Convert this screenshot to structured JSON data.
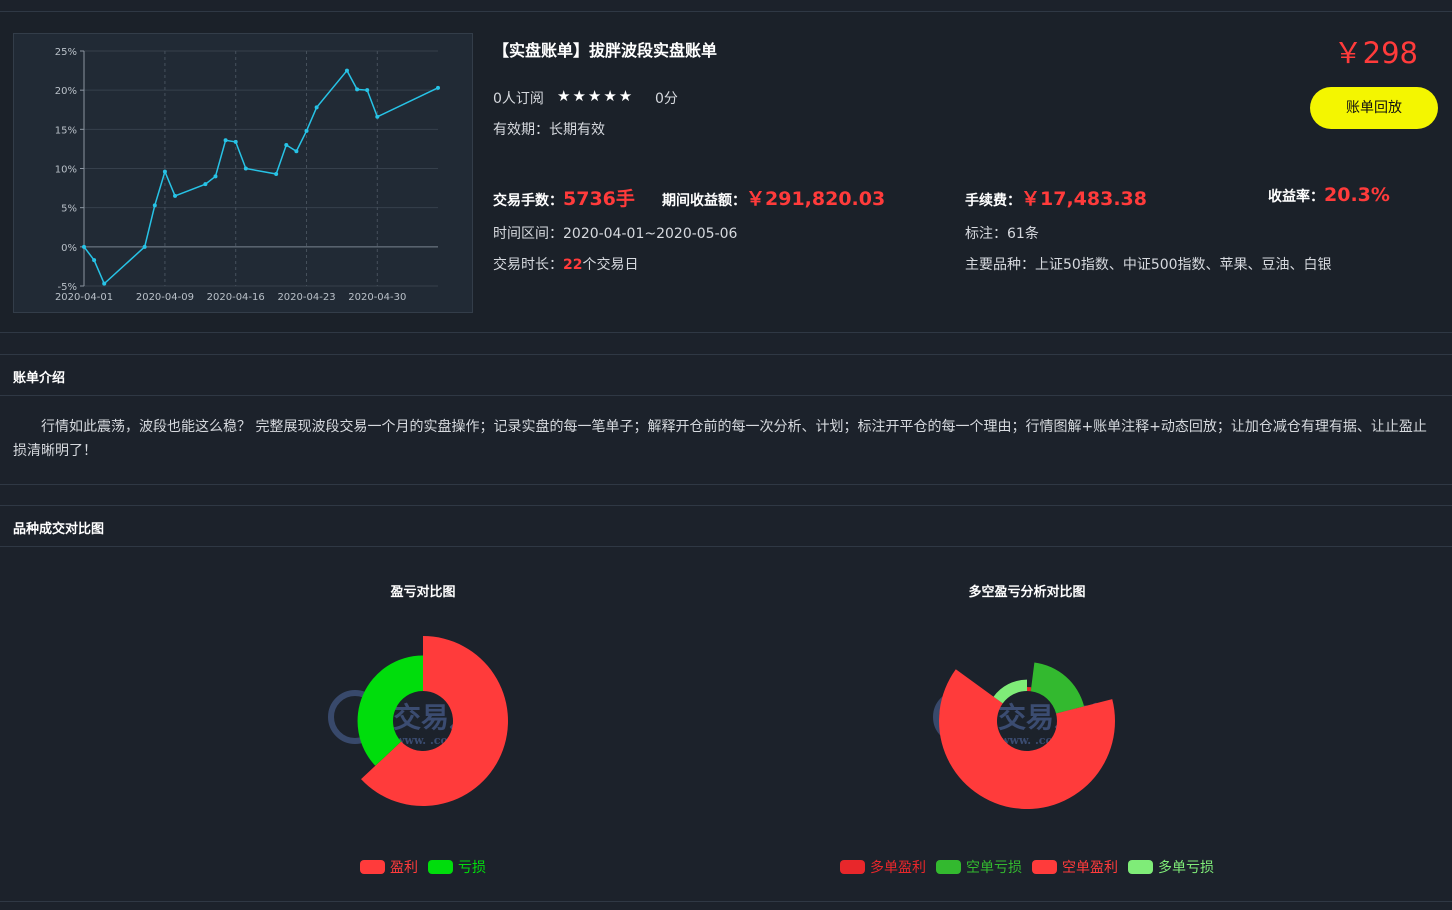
{
  "header": {
    "title": "【实盘账单】拔胖波段实盘账单",
    "price": "￥298",
    "replay_button": "账单回放",
    "subscribers": "0人订阅",
    "stars": "★★★★★",
    "score": "0分",
    "validity_label": "有效期：",
    "validity_value": "长期有效"
  },
  "stats": {
    "lots_label": "交易手数：",
    "lots_value": "5736手",
    "profit_label": "期间收益额：",
    "profit_value": "￥291,820.03",
    "fee_label": "手续费：",
    "fee_value": "￥17,483.38",
    "yield_label": "收益率：",
    "yield_value": "20.3%",
    "range_label": "时间区间：",
    "range_value": "2020-04-01~2020-05-06",
    "notes_label": "标注：",
    "notes_value": "61条",
    "duration_label": "交易时长：",
    "duration_days": "22",
    "duration_unit": "个交易日",
    "varieties_label": "主要品种：",
    "varieties_value": "上证50指数、中证500指数、苹果、豆油、白银"
  },
  "sections": {
    "intro_title": "账单介绍",
    "intro_text": "行情如此震荡，波段也能这么稳？ 完整展现波段交易一个月的实盘操作；记录实盘的每一笔单子；解释开仓前的每一次分析、计划；标注开平仓的每一个理由；行情图解+账单注释+动态回放；让加仓减仓有理有据、让止盈止损清晰明了！",
    "compare_title": "品种成交对比图"
  },
  "watermark": {
    "text": "交易之家",
    "url": "www.        .com"
  },
  "colors": {
    "line": "#27c3e6",
    "profit": "#ff3b3b",
    "loss": "#00dd0c",
    "long_profit": "#e8272b",
    "short_loss": "#33b92f",
    "short_profit": "#ff3b3b",
    "long_loss": "#7fec78",
    "accent_button": "#f4f600"
  },
  "chart_data": [
    {
      "type": "line",
      "x": [
        "2020-04-01",
        "2020-04-02",
        "2020-04-03",
        "2020-04-07",
        "2020-04-08",
        "2020-04-09",
        "2020-04-10",
        "2020-04-13",
        "2020-04-14",
        "2020-04-15",
        "2020-04-16",
        "2020-04-17",
        "2020-04-20",
        "2020-04-21",
        "2020-04-22",
        "2020-04-23",
        "2020-04-24",
        "2020-04-27",
        "2020-04-28",
        "2020-04-29",
        "2020-04-30",
        "2020-05-06"
      ],
      "y": [
        0,
        -1.7,
        -4.7,
        0,
        5.3,
        9.6,
        6.5,
        8,
        9,
        13.6,
        13.4,
        10,
        9.3,
        13,
        12.2,
        14.8,
        17.8,
        22.5,
        20.1,
        20,
        16.6,
        20.3
      ],
      "xticks": [
        "2020-04-01",
        "2020-04-09",
        "2020-04-16",
        "2020-04-23",
        "2020-04-30"
      ],
      "yticks": [
        "25%",
        "20%",
        "15%",
        "10%",
        "5%",
        "0%",
        "-5%"
      ],
      "ylim": [
        -5,
        25
      ],
      "title": "",
      "xlabel": "",
      "ylabel": ""
    },
    {
      "type": "pie",
      "title": "盈亏对比图",
      "labels": [
        "盈利",
        "亏损"
      ],
      "values": [
        63,
        37
      ],
      "radius": [
        1.0,
        0.77
      ]
    },
    {
      "type": "pie",
      "title": "多空盈亏分析对比图",
      "labels": [
        "多单盈利",
        "空单亏损",
        "空单盈利",
        "多单亏损"
      ],
      "values": [
        2,
        19,
        64,
        15
      ],
      "radius": [
        0.25,
        0.67,
        1.0,
        0.47
      ]
    }
  ]
}
